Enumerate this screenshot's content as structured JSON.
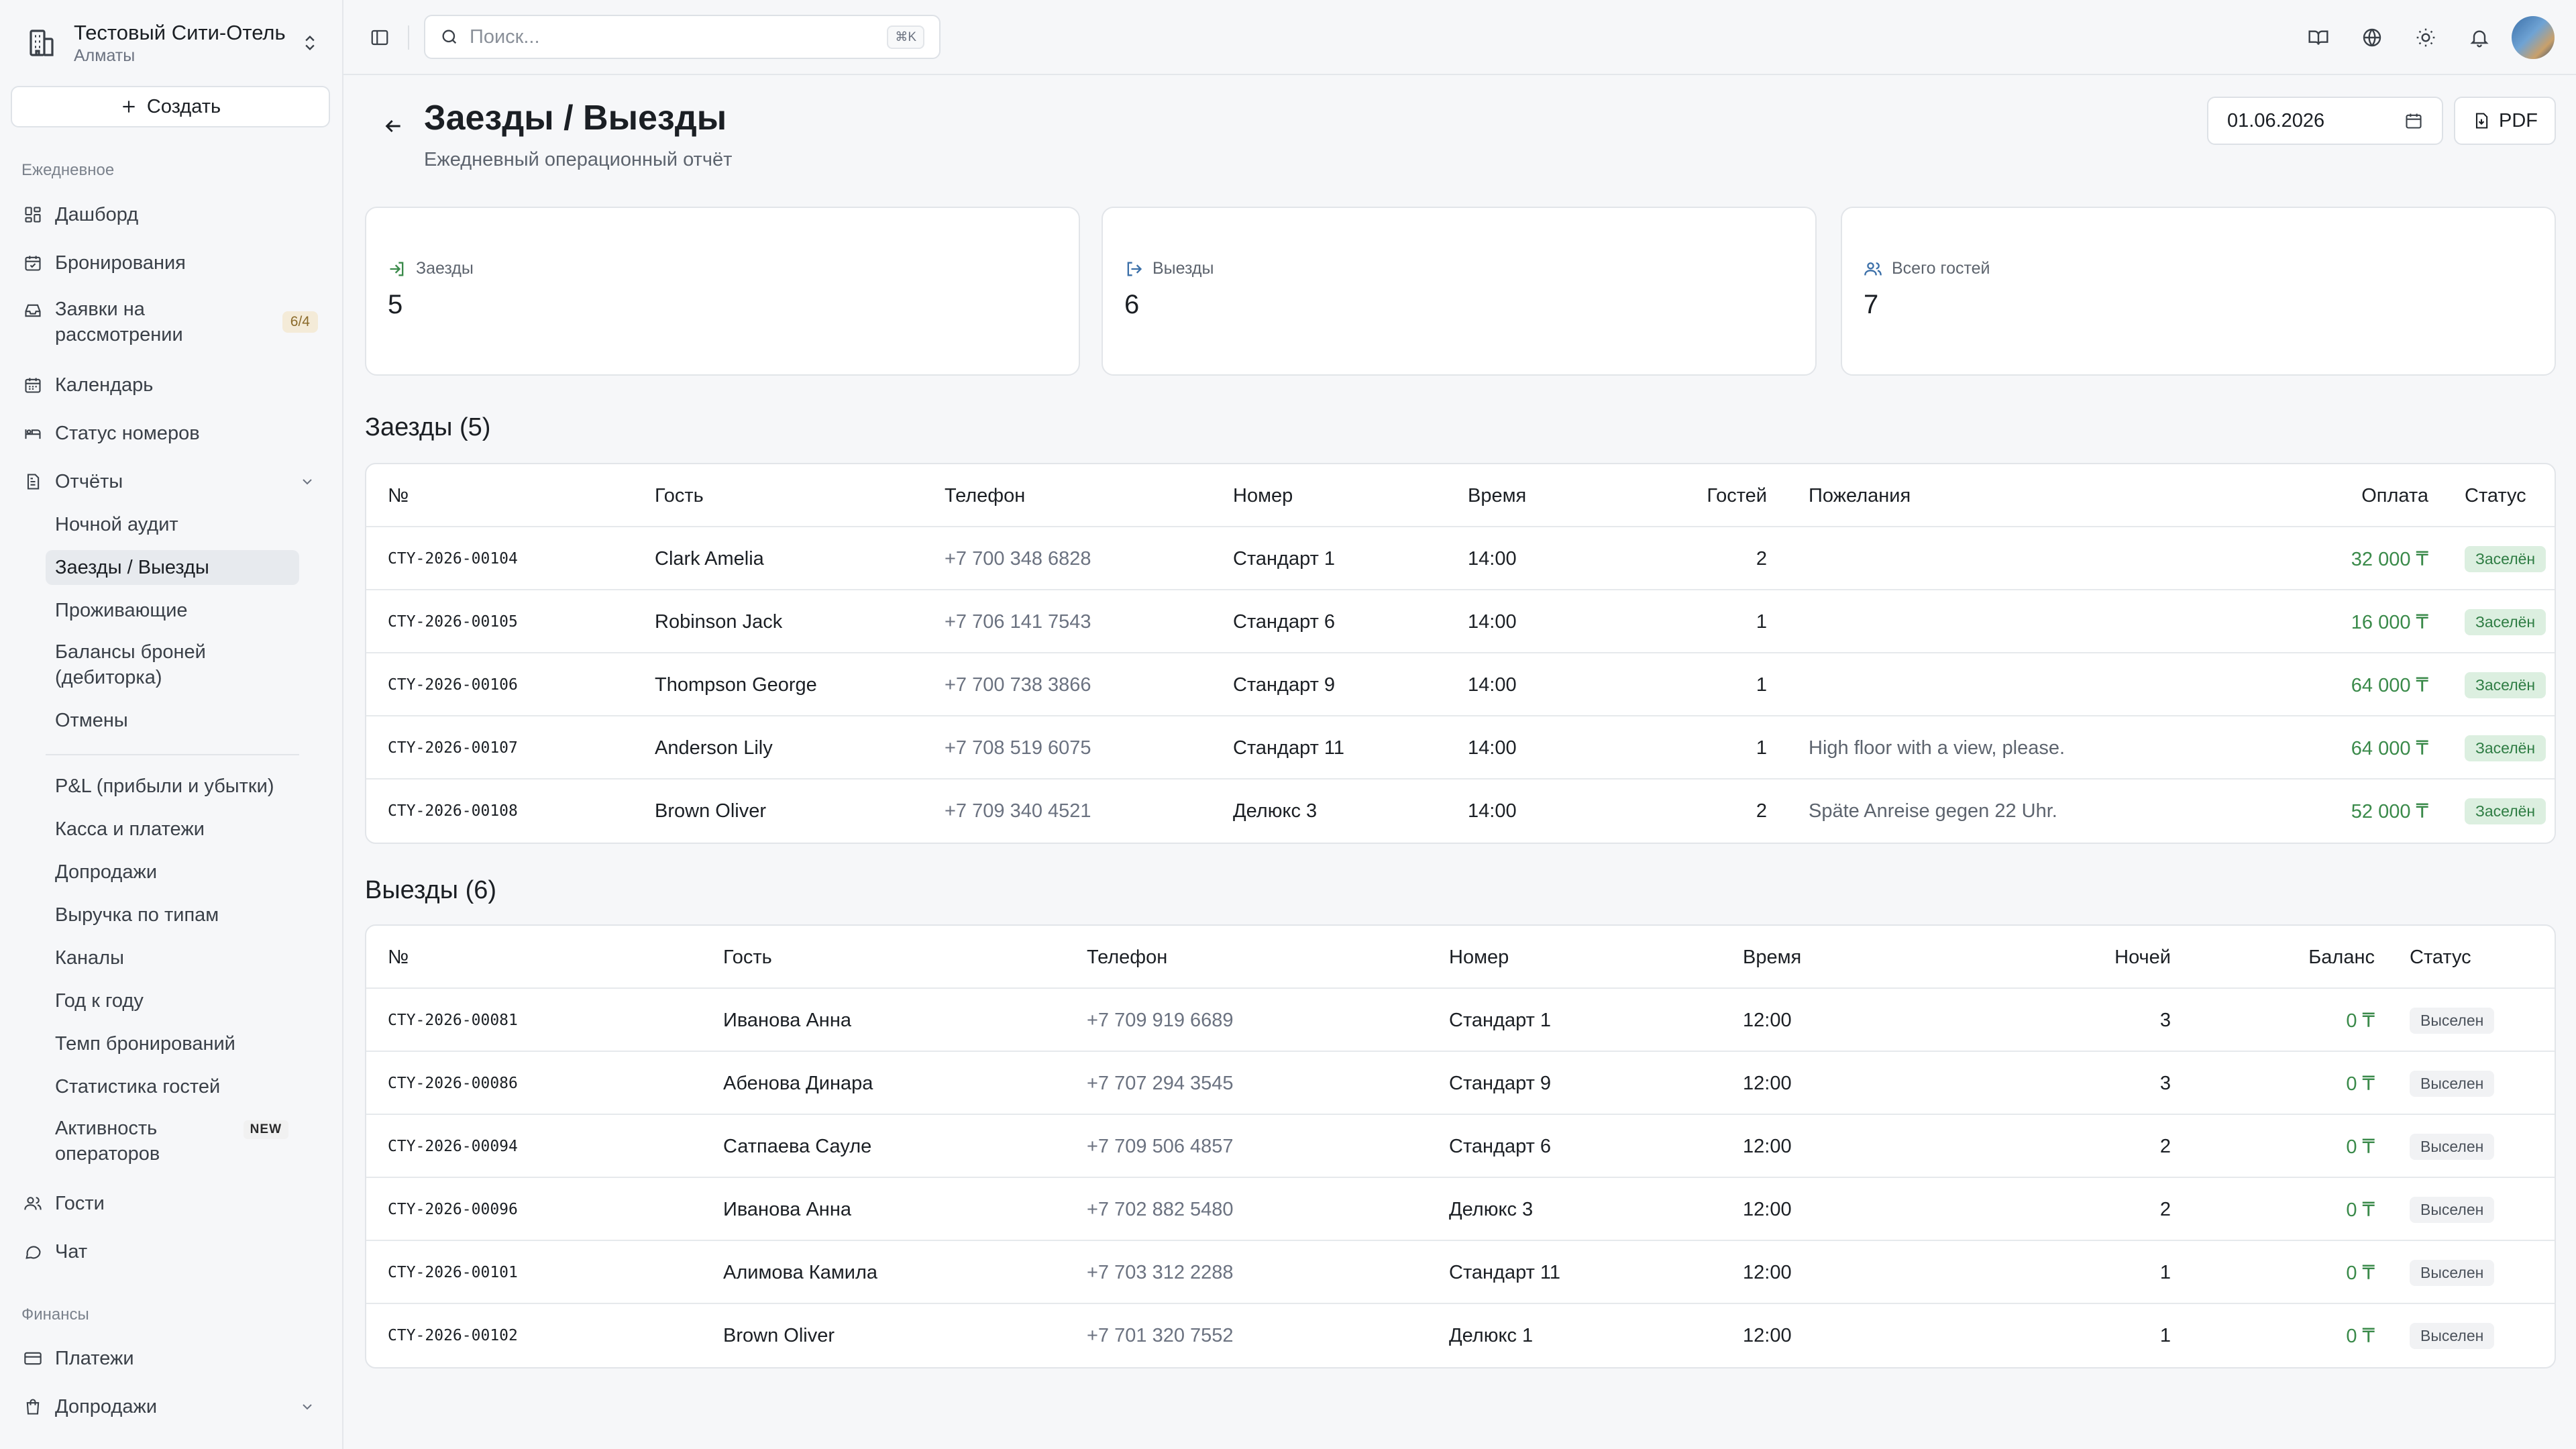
{
  "sidebar": {
    "hotel_name": "Тестовый Сити-Отель",
    "hotel_city": "Алматы",
    "create_label": "Создать",
    "section_daily": "Ежедневное",
    "items": {
      "dashboard": "Дашборд",
      "bookings": "Бронирования",
      "requests": "Заявки на рассмотрении",
      "requests_badge": "6/4",
      "calendar": "Календарь",
      "room_status": "Статус номеров",
      "reports": "Отчёты",
      "guests": "Гости",
      "chat": "Чат"
    },
    "reports_sub": {
      "night_audit": "Ночной аудит",
      "arrivals_departures": "Заезды / Выезды",
      "residents": "Проживающие",
      "balances": "Балансы броней (дебиторка)",
      "cancellations": "Отмены",
      "pnl": "P&L (прибыли и убытки)",
      "cash": "Касса и платежи",
      "upsells": "Допродажи",
      "revenue_types": "Выручка по типам",
      "channels": "Каналы",
      "yoy": "Год к году",
      "pace": "Темп бронирований",
      "guest_stats": "Статистика гостей",
      "operators": "Активность операторов",
      "new_badge": "NEW"
    },
    "section_finance": "Финансы",
    "finance": {
      "payments": "Платежи",
      "upsells": "Допродажи"
    }
  },
  "topbar": {
    "search_placeholder": "Поиск...",
    "search_kbd": "⌘K"
  },
  "page": {
    "title": "Заезды / Выезды",
    "subtitle": "Ежедневный операционный отчёт",
    "date": "01.06.2026",
    "pdf_label": "PDF"
  },
  "cards": {
    "arrivals_label": "Заезды",
    "arrivals_value": "5",
    "departures_label": "Выезды",
    "departures_value": "6",
    "guests_label": "Всего гостей",
    "guests_value": "7"
  },
  "arrivals": {
    "heading": "Заезды (5)",
    "columns": [
      "№",
      "Гость",
      "Телефон",
      "Номер",
      "Время",
      "Гостей",
      "Пожелания",
      "Оплата",
      "Статус"
    ],
    "rows": [
      {
        "id": "CTY-2026-00104",
        "guest": "Clark Amelia",
        "phone": "+7 700 348 6828",
        "room": "Стандарт 1",
        "time": "14:00",
        "guests": "2",
        "requests": "",
        "payment": "32 000 ₸",
        "status": "Заселён"
      },
      {
        "id": "CTY-2026-00105",
        "guest": "Robinson Jack",
        "phone": "+7 706 141 7543",
        "room": "Стандарт 6",
        "time": "14:00",
        "guests": "1",
        "requests": "",
        "payment": "16 000 ₸",
        "status": "Заселён"
      },
      {
        "id": "CTY-2026-00106",
        "guest": "Thompson George",
        "phone": "+7 700 738 3866",
        "room": "Стандарт 9",
        "time": "14:00",
        "guests": "1",
        "requests": "",
        "payment": "64 000 ₸",
        "status": "Заселён"
      },
      {
        "id": "CTY-2026-00107",
        "guest": "Anderson Lily",
        "phone": "+7 708 519 6075",
        "room": "Стандарт 11",
        "time": "14:00",
        "guests": "1",
        "requests": "High floor with a view, please.",
        "payment": "64 000 ₸",
        "status": "Заселён"
      },
      {
        "id": "CTY-2026-00108",
        "guest": "Brown Oliver",
        "phone": "+7 709 340 4521",
        "room": "Делюкс 3",
        "time": "14:00",
        "guests": "2",
        "requests": "Späte Anreise gegen 22 Uhr.",
        "payment": "52 000 ₸",
        "status": "Заселён"
      }
    ]
  },
  "departures": {
    "heading": "Выезды (6)",
    "columns": [
      "№",
      "Гость",
      "Телефон",
      "Номер",
      "Время",
      "Ночей",
      "Баланс",
      "Статус"
    ],
    "rows": [
      {
        "id": "CTY-2026-00081",
        "guest": "Иванова Анна",
        "phone": "+7 709 919 6689",
        "room": "Стандарт 1",
        "time": "12:00",
        "nights": "3",
        "balance": "0 ₸",
        "status": "Выселен"
      },
      {
        "id": "CTY-2026-00086",
        "guest": "Абенова Динара",
        "phone": "+7 707 294 3545",
        "room": "Стандарт 9",
        "time": "12:00",
        "nights": "3",
        "balance": "0 ₸",
        "status": "Выселен"
      },
      {
        "id": "CTY-2026-00094",
        "guest": "Сатпаева Сауле",
        "phone": "+7 709 506 4857",
        "room": "Стандарт 6",
        "time": "12:00",
        "nights": "2",
        "balance": "0 ₸",
        "status": "Выселен"
      },
      {
        "id": "CTY-2026-00096",
        "guest": "Иванова Анна",
        "phone": "+7 702 882 5480",
        "room": "Делюкс 3",
        "time": "12:00",
        "nights": "2",
        "balance": "0 ₸",
        "status": "Выселен"
      },
      {
        "id": "CTY-2026-00101",
        "guest": "Алимова Камила",
        "phone": "+7 703 312 2288",
        "room": "Стандарт 11",
        "time": "12:00",
        "nights": "1",
        "balance": "0 ₸",
        "status": "Выселен"
      },
      {
        "id": "CTY-2026-00102",
        "guest": "Brown Oliver",
        "phone": "+7 701 320 7552",
        "room": "Делюкс 1",
        "time": "12:00",
        "nights": "1",
        "balance": "0 ₸",
        "status": "Выселен"
      }
    ]
  }
}
